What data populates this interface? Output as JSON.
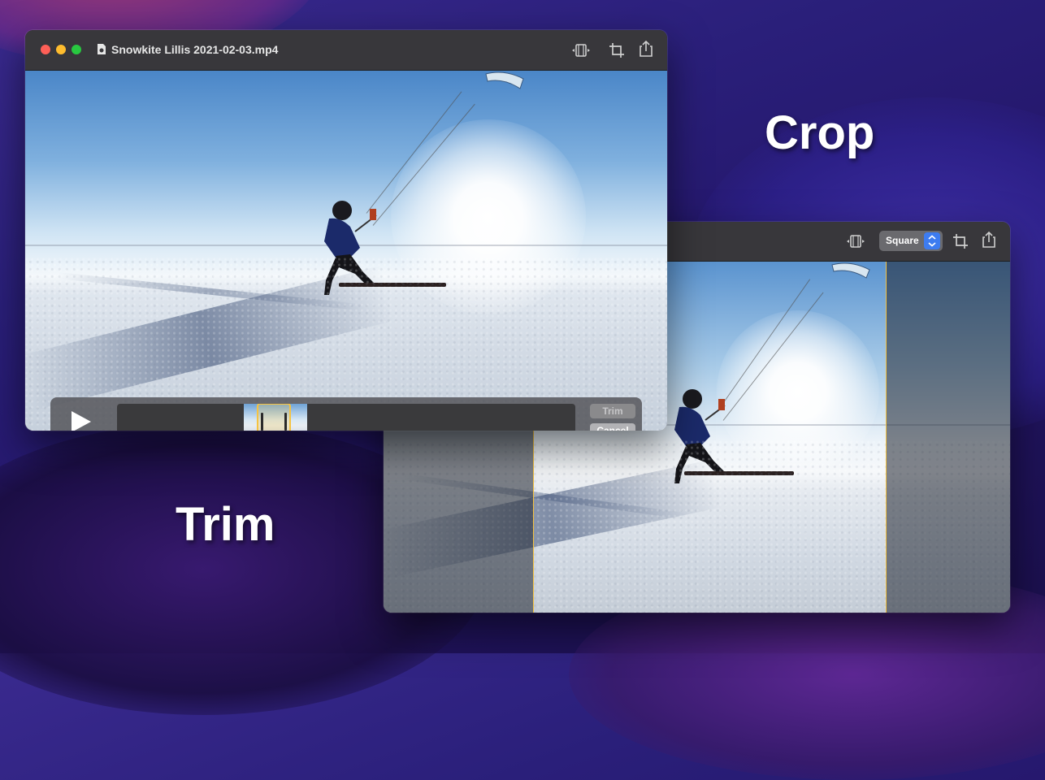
{
  "labels": {
    "crop": "Crop",
    "trim": "Trim"
  },
  "front_window": {
    "title": "Snowkite Lillis 2021-02-03.mp4",
    "toolbar_icons": [
      "trim-icon",
      "crop-icon",
      "share-icon"
    ],
    "trim_bar": {
      "play_icon": "play-icon",
      "trim_button": "Trim",
      "cancel_button": "Cancel"
    }
  },
  "back_window": {
    "aspect_select": {
      "value": "Square"
    },
    "toolbar_icons": [
      "trim-icon",
      "crop-icon",
      "share-icon"
    ]
  },
  "colors": {
    "accent_yellow": "#f5c342",
    "select_blue": "#3d7cf0",
    "titlebar": "#38373b"
  }
}
